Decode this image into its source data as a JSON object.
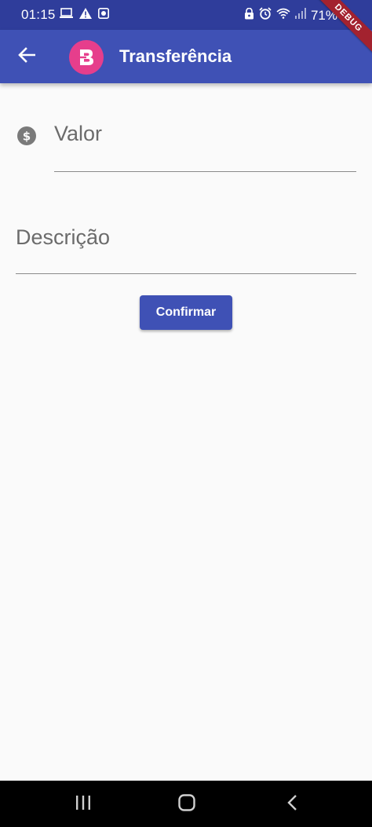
{
  "status_bar": {
    "time": "01:15",
    "battery": "71%",
    "left_icons": [
      "laptop-icon",
      "warning-icon",
      "notification-icon"
    ],
    "right_icons": [
      "lock-icon",
      "alarm-icon",
      "wifi-icon",
      "signal-icon"
    ]
  },
  "debug_banner": "DEBUG",
  "app_bar": {
    "title": "Transferência",
    "logo_letter": "B",
    "back_icon": "arrow-back-icon"
  },
  "form": {
    "valor_label": "Valor",
    "valor_icon": "dollar-circle-icon",
    "descricao_label": "Descrição",
    "confirm_label": "Confirmar"
  },
  "nav_bar": {
    "buttons": [
      "recent-apps-icon",
      "home-icon",
      "back-icon"
    ]
  },
  "colors": {
    "status_bar": "#2f3d9b",
    "app_bar": "#3f51b5",
    "logo": "#e63e8c",
    "button": "#3f51b5",
    "background": "#fafafa",
    "debug": "#a3222f"
  }
}
